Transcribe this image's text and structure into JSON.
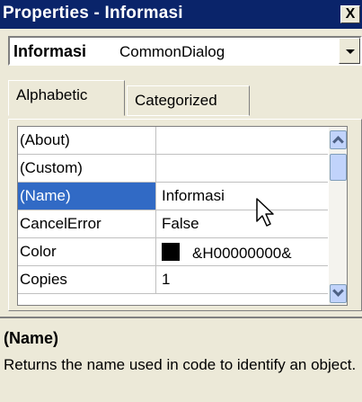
{
  "window": {
    "title": "Properties - Informasi",
    "close_label": "X"
  },
  "object_selector": {
    "name": "Informasi",
    "type": "CommonDialog"
  },
  "tabs": [
    {
      "label": "Alphabetic",
      "active": true
    },
    {
      "label": "Categorized",
      "active": false
    }
  ],
  "properties": [
    {
      "name": "(About)",
      "value": ""
    },
    {
      "name": "(Custom)",
      "value": ""
    },
    {
      "name": "(Name)",
      "value": "Informasi"
    },
    {
      "name": "CancelError",
      "value": "False"
    },
    {
      "name": "Color",
      "value": "&H00000000&",
      "swatch": "#000000"
    },
    {
      "name": "Copies",
      "value": "1"
    }
  ],
  "selected_property": "(Name)",
  "description": {
    "title": "(Name)",
    "text": "Returns the name used in code to identify an object."
  },
  "colors": {
    "title_bar": "#0a246a",
    "selection": "#316ac5",
    "chrome": "#ece9d8"
  }
}
